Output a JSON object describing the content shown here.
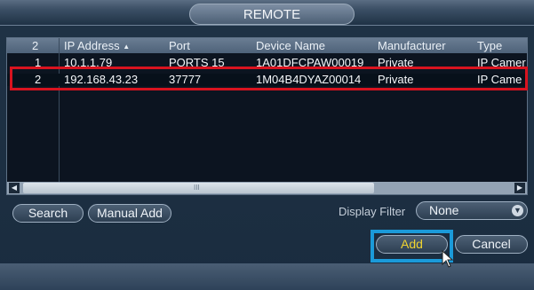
{
  "window": {
    "title": "REMOTE"
  },
  "table": {
    "columns": [
      {
        "key": "count",
        "label": "2"
      },
      {
        "key": "ip",
        "label": "IP Address",
        "sort_indicator": "▲"
      },
      {
        "key": "port",
        "label": "Port"
      },
      {
        "key": "name",
        "label": "Device Name"
      },
      {
        "key": "manufacturer",
        "label": "Manufacturer"
      },
      {
        "key": "type",
        "label": "Type"
      }
    ],
    "rows": [
      {
        "index": "1",
        "ip": "10.1.1.79",
        "port": "PORTS 15",
        "name": "1A01DFCPAW00019",
        "manufacturer": "Private",
        "type": "IP Camer"
      },
      {
        "index": "2",
        "ip": "192.168.43.23",
        "port": "37777",
        "name": "1M04B4DYAZ00014",
        "manufacturer": "Private",
        "type": "IP Came",
        "selected": true
      }
    ],
    "scrollbar": {
      "grip": "III",
      "left_arrow": "◀",
      "right_arrow": "▶"
    }
  },
  "buttons": {
    "search": "Search",
    "manual_add": "Manual Add",
    "add": "Add",
    "cancel": "Cancel"
  },
  "filter": {
    "label": "Display Filter",
    "value": "None",
    "chevron": "▼"
  },
  "colors": {
    "selection_highlight": "#d8131f",
    "add_highlight": "#1b9ad9",
    "add_text": "#f0d430"
  },
  "icons": {
    "cursor": "mouse-pointer-icon"
  }
}
